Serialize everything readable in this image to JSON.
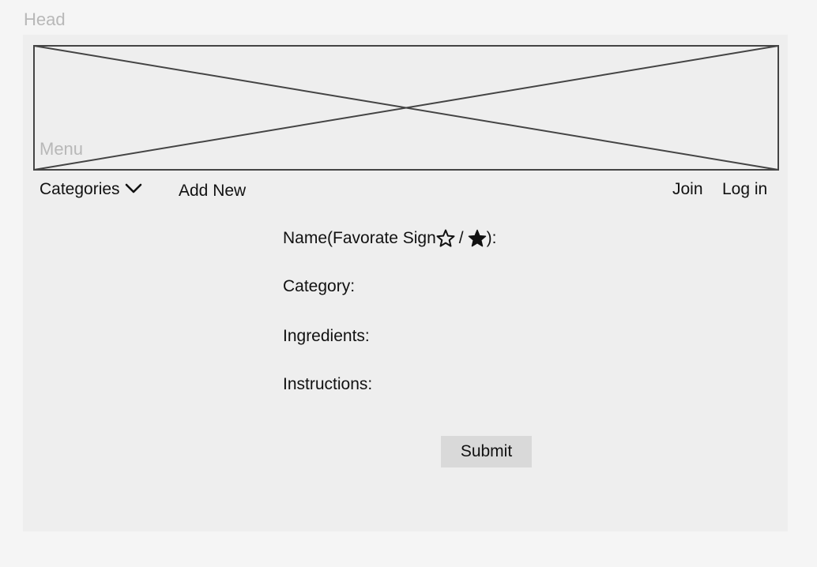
{
  "head": {
    "label": "Head"
  },
  "banner": {
    "menu_label": "Menu"
  },
  "nav": {
    "categories_label": "Categories",
    "add_new_label": "Add New",
    "join_label": "Join",
    "login_label": "Log in"
  },
  "form": {
    "name_label_prefix": "Name(Favorate Sign",
    "name_label_slash": "/",
    "name_label_suffix": "):",
    "category_label": "Category:",
    "ingredients_label": "Ingredients:",
    "instructions_label": "Instructions:",
    "submit_label": "Submit"
  },
  "icons": {
    "categories_toggle": "chevron-down-icon",
    "favorite_outline": "star-outline-icon",
    "favorite_filled": "star-filled-icon"
  },
  "colors": {
    "page_background": "#f5f5f5",
    "frame_background": "#eeeeee",
    "placeholder_text": "#b8b8b8",
    "button_background": "#d9d9d9",
    "banner_stroke": "#444444"
  }
}
